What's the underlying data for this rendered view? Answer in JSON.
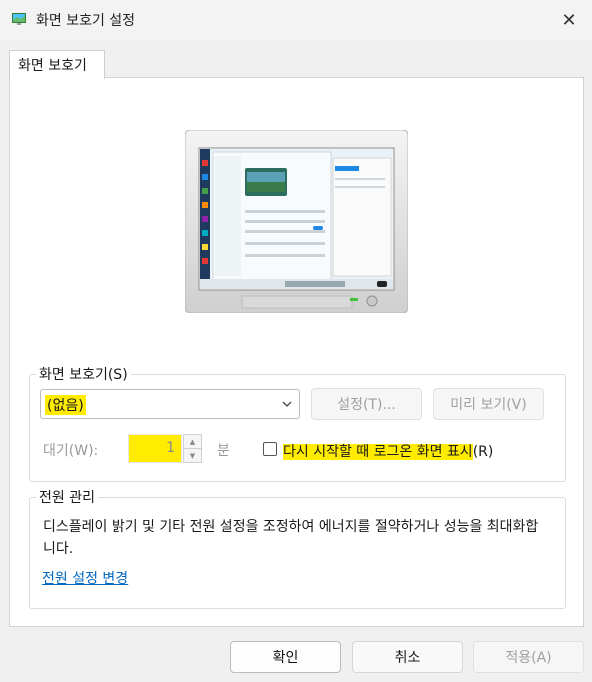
{
  "window": {
    "title": "화면 보호기 설정",
    "close_glyph": "✕"
  },
  "tab": {
    "label": "화면 보호기"
  },
  "screensaver": {
    "group_label": "화면 보호기(S)",
    "selected": "(없음)",
    "settings_button": "설정(T)...",
    "preview_button": "미리 보기(V)",
    "wait_label": "대기(W):",
    "wait_value": "1",
    "minutes_label": "분",
    "resume_checkbox_label": "다시 시작할 때 로그온 화면 표시",
    "resume_checkbox_suffix": "(R)",
    "resume_checked": false
  },
  "power": {
    "group_label": "전원 관리",
    "description": "디스플레이 밝기 및 기타 전원 설정을 조정하여 에너지를 절약하거나 성능을 최대화합니다.",
    "link": "전원 설정 변경"
  },
  "footer": {
    "ok": "확인",
    "cancel": "취소",
    "apply": "적용(A)"
  },
  "colors": {
    "highlight": "#ffec00",
    "link": "#0067c0"
  }
}
